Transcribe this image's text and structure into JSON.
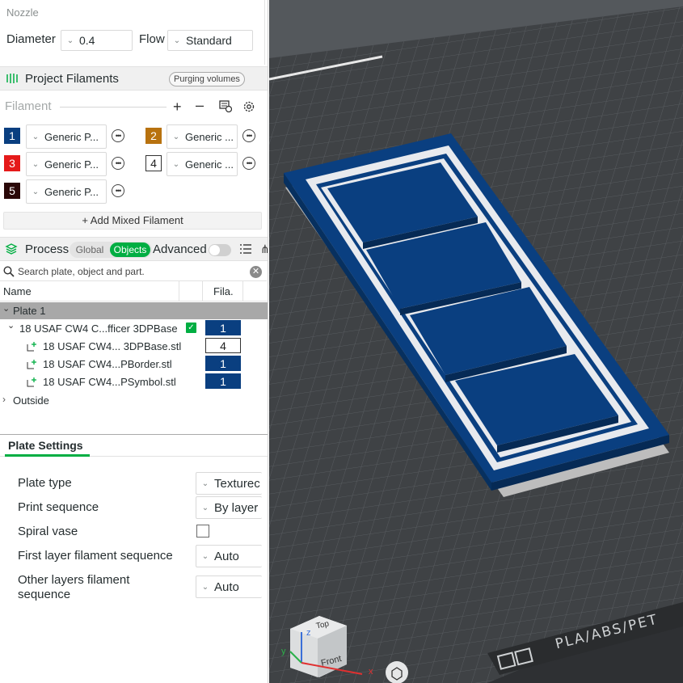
{
  "nozzle": {
    "section_label": "Nozzle",
    "diameter_label": "Diameter",
    "diameter_value": "0.4",
    "flow_label": "Flow",
    "flow_value": "Standard"
  },
  "project_filaments": {
    "title": "Project Filaments",
    "purging_button": "Purging volumes",
    "filament_label": "Filament",
    "slots": [
      {
        "number": "1",
        "color": "#0a3f80",
        "name": "Generic P..."
      },
      {
        "number": "2",
        "color": "#b8720f",
        "name": "Generic ..."
      },
      {
        "number": "3",
        "color": "#e51a1a",
        "name": "Generic P..."
      },
      {
        "number": "4",
        "color": "#ffffff",
        "name": "Generic ..."
      },
      {
        "number": "5",
        "color": "#2a0808",
        "name": "Generic P..."
      }
    ],
    "add_mixed": "+ Add Mixed Filament"
  },
  "process": {
    "title": "Process",
    "toggle_global": "Global",
    "toggle_objects": "Objects",
    "advanced_label": "Advanced",
    "search_placeholder": "Search plate, object and part.",
    "col_name": "Name",
    "col_fila": "Fila.",
    "plate_label": "Plate 1",
    "object_name": "18 USAF CW4 C...fficer 3DPBase",
    "object_fila": "1",
    "parts": [
      {
        "name": "18 USAF CW4... 3DPBase.stl",
        "fila": "4"
      },
      {
        "name": "18 USAF CW4...PBorder.stl",
        "fila": "1"
      },
      {
        "name": "18 USAF CW4...PSymbol.stl",
        "fila": "1"
      }
    ],
    "outside_label": "Outside"
  },
  "plate_settings": {
    "tab_label": "Plate Settings",
    "plate_type_label": "Plate type",
    "plate_type_value": "Texturec",
    "print_sequence_label": "Print sequence",
    "print_sequence_value": "By layer",
    "spiral_vase_label": "Spiral vase",
    "first_layer_label": "First layer filament sequence",
    "first_layer_value": "Auto",
    "other_layers_label": "Other layers filament sequence",
    "other_layers_value": "Auto"
  },
  "viewport": {
    "bed_label": "PLA/ABS/PET",
    "cube_top": "Top",
    "cube_front": "Front",
    "axis_x": "x",
    "axis_y": "y",
    "axis_z": "z"
  },
  "colors": {
    "accent_green": "#00ae42",
    "model_blue": "#0a3f80",
    "bed_dark": "#3f4245"
  }
}
